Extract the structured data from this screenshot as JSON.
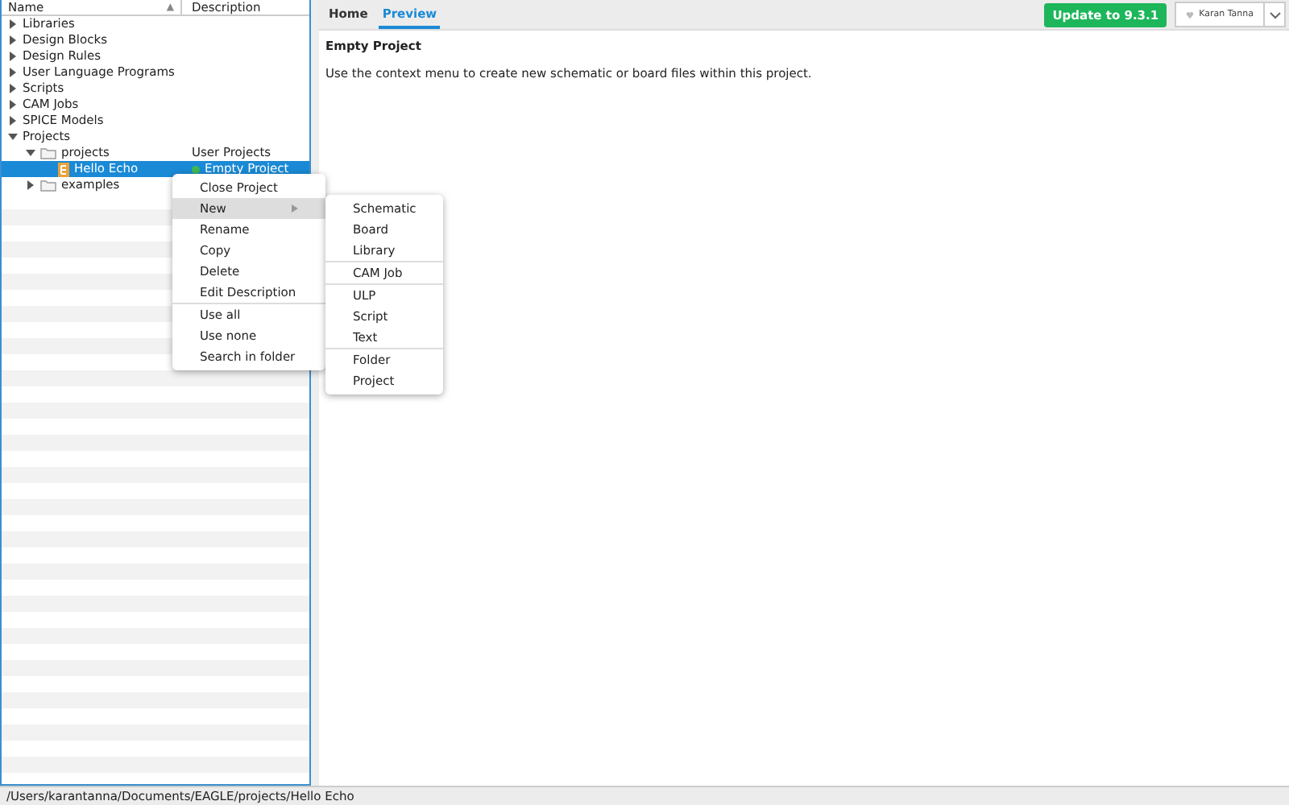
{
  "tree": {
    "columns": [
      {
        "label": "Name",
        "sort": "▲"
      },
      {
        "label": "Description"
      }
    ],
    "items": [
      {
        "label": "Libraries",
        "expanded": false,
        "selected": false
      },
      {
        "label": "Design Blocks",
        "expanded": false,
        "selected": false
      },
      {
        "label": "Design Rules",
        "expanded": false,
        "selected": false
      },
      {
        "label": "User Language Programs",
        "expanded": false,
        "selected": false
      },
      {
        "label": "Scripts",
        "expanded": false,
        "selected": false
      },
      {
        "label": "CAM Jobs",
        "expanded": false,
        "selected": false
      },
      {
        "label": "SPICE Models",
        "expanded": false,
        "selected": false
      },
      {
        "label": "Projects",
        "expanded": true,
        "selected": false,
        "children": [
          {
            "label": "projects",
            "kind": "folder",
            "description": "User Projects",
            "expanded": true,
            "selected": false,
            "children": [
              {
                "label": "Hello Echo",
                "kind": "project",
                "description": "Empty Project",
                "selected": true
              }
            ]
          },
          {
            "label": "examples",
            "kind": "folder",
            "expanded": false,
            "selected": false
          }
        ]
      }
    ]
  },
  "context_menu": {
    "items": [
      {
        "label": "Close Project",
        "selected": false
      },
      {
        "label": "New",
        "selected": true,
        "submenu": true
      },
      {
        "label": "Rename",
        "selected": false
      },
      {
        "label": "Copy",
        "selected": false
      },
      {
        "label": "Delete",
        "selected": false
      },
      {
        "label": "Edit Description",
        "selected": false,
        "separator_after": true
      },
      {
        "label": "Use all",
        "selected": false
      },
      {
        "label": "Use none",
        "selected": false
      },
      {
        "label": "Search in folder",
        "selected": false
      }
    ]
  },
  "submenu": {
    "items": [
      {
        "label": "Schematic"
      },
      {
        "label": "Board"
      },
      {
        "label": "Library"
      },
      {
        "label": "CAM Job",
        "separator_before": true
      },
      {
        "label": "ULP",
        "separator_before": true
      },
      {
        "label": "Script"
      },
      {
        "label": "Text"
      },
      {
        "label": "Folder",
        "separator_before": true
      },
      {
        "label": "Project"
      }
    ]
  },
  "tabs": [
    {
      "label": "Home",
      "selected": false
    },
    {
      "label": "Preview",
      "selected": true
    }
  ],
  "update_button": "Update to 9.3.1",
  "user": "Karan Tanna",
  "preview": {
    "title": "Empty Project",
    "text": "Use the context menu to create new schematic or board files within this project."
  },
  "status_bar": "/Users/karantanna/Documents/EAGLE/projects/Hello Echo"
}
